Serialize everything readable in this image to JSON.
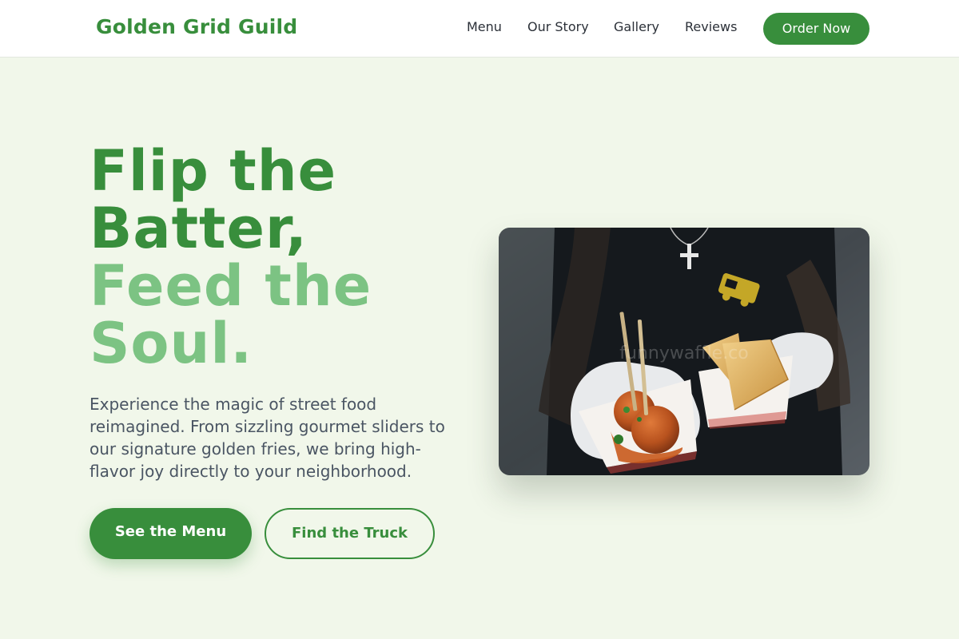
{
  "brand": {
    "name": "Golden Grid Guild"
  },
  "nav": {
    "links": [
      "Menu",
      "Our Story",
      "Gallery",
      "Reviews"
    ],
    "cta": "Order Now"
  },
  "hero": {
    "title_dark_1": "Flip the",
    "title_dark_2": "Batter,",
    "title_light_1": "Feed the",
    "title_light_2": "Soul.",
    "description": "Experience the magic of street food reimagined. From sizzling gourmet sliders to our signature golden fries, we bring high-flavor joy directly to your neighborhood.",
    "primary_button": "See the Menu",
    "secondary_button": "Find the Truck",
    "image_watermark": "funnywaffle.co"
  },
  "colors": {
    "brand_green": "#388e3c",
    "light_green": "#7cc383",
    "page_background": "#f1f7ea"
  }
}
